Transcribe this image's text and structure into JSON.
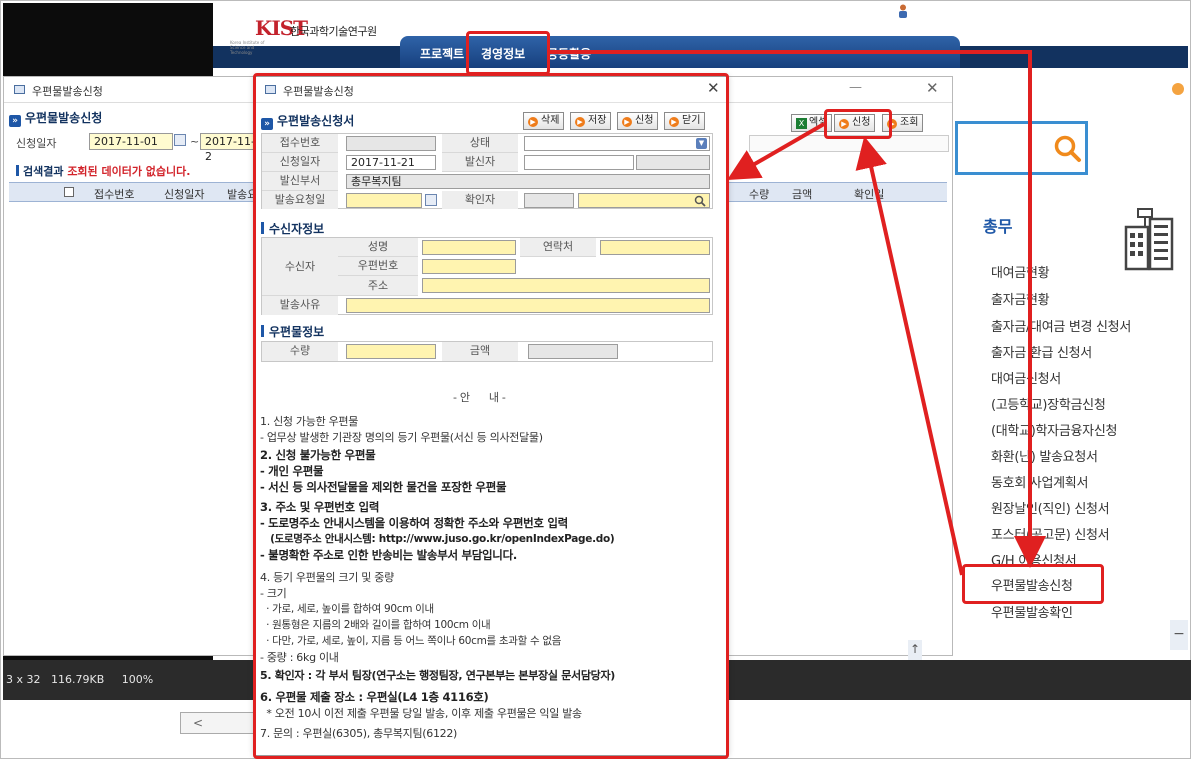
{
  "viewer": {
    "info": "3 x 32   116.79KB     100%"
  },
  "portal": {
    "logo": "KIST",
    "logo_sub": "Korea Institute of Science and Technology",
    "org_name": "한국과학기술연구원",
    "nav": [
      "프로젝트",
      "경영정보",
      "공동활용"
    ]
  },
  "bg_window": {
    "title": "우편물발송신청",
    "header": "우편물발송신청",
    "date_label": "신청일자",
    "date_from": "2017-11-01",
    "tilde": "~",
    "date_to": "2017-11-2",
    "msg_prefix": "검색결과 ",
    "msg_highlight": "조회된 데이터가 없습니다.",
    "columns_left": [
      "접수번호",
      "신청일자",
      "발송요"
    ],
    "columns_right": [
      "수량",
      "금액",
      "확인일"
    ],
    "btn_excel": "엑셀",
    "btn_apply": "신청",
    "btn_search": "조회"
  },
  "modal": {
    "title": "우편물발송신청",
    "header": "우편발송신청서",
    "buttons": {
      "delete": "삭제",
      "save": "저장",
      "apply": "신청",
      "close": "닫기"
    },
    "form": {
      "receipt_no_label": "접수번호",
      "status_label": "상태",
      "apply_date_label": "신청일자",
      "apply_date": "2017-11-21",
      "sender_label": "발신자",
      "dept_label": "발신부서",
      "dept": "총무복지팀",
      "request_date_label": "발송요청일",
      "confirmer_label": "확인자"
    },
    "recipient": {
      "section": "수신자정보",
      "group_label": "수신자",
      "name_label": "성명",
      "contact_label": "연락처",
      "zip_label": "우편번호",
      "address_label": "주소",
      "reason_label": "발송사유"
    },
    "mail": {
      "section": "우편물정보",
      "qty_label": "수량",
      "amount_label": "금액"
    },
    "guide": {
      "heading": "- 안      내 -",
      "lines": [
        "1. 신청 가능한 우편물",
        " - 업무상 발생한 기관장 명의의 등기 우편물(서신 등 의사전달물)",
        "2. 신청 불가능한 우편물",
        " - 개인 우편물",
        " - 서신 등 의사전달물을 제외한 물건을 포장한 우편물",
        "3. 주소 및 우편번호 입력",
        " - 도로명주소 안내시스템을 이용하여 정확한 주소와 우편번호 입력",
        "   (도로명주소 안내시스템: http://www.juso.go.kr/openIndexPage.do)",
        " - 불명확한 주소로 인한 반송비는 발송부서 부담입니다.",
        "4. 등기 우편물의 크기 및 중량",
        " - 크기",
        "  · 가로, 세로, 높이를 합하여 90cm 이내",
        "  · 원통형은 지름의 2배와 길이를 합하여 100cm 이내",
        "  · 다만, 가로, 세로, 높이, 지름 등 어느 쪽이나 60cm를 초과할 수 없음",
        " - 중량 : 6kg 이내",
        "5. 확인자 : 각 부서 팀장(연구소는 행정팀장, 연구본부는 본부장실 문서담당자)",
        "6. 우편물 제출 장소 : 우편실(L4 1층 4116호)",
        "  * 오전 10시 이전 제출 우편물 당일 발송, 이후 제출 우편물은 익일 발송",
        "7. 문의 : 우편실(6305), 총무복지팀(6122)"
      ]
    }
  },
  "side_menu": {
    "title": "총무",
    "items": [
      "대여금현황",
      "출자금현황",
      "출자금/대여금 변경 신청서",
      "출자금 환급 신청서",
      "대여금신청서",
      "(고등학교)장학금신청",
      "(대학교)학자금융자신청",
      "화환(난) 발송요청서",
      "동호회 사업계획서",
      "원장날인(직인) 신청서",
      "포스터(공고문) 신청서",
      "G/H 이용신청서",
      "우편물발송신청",
      "우편물발송확인"
    ]
  },
  "colors": {
    "annotation_red": "#e02020",
    "navy": "#12325f",
    "accent_blue": "#1e57a7",
    "button_orange": "#ef7c1a",
    "field_yellow": "#fff4b0"
  }
}
